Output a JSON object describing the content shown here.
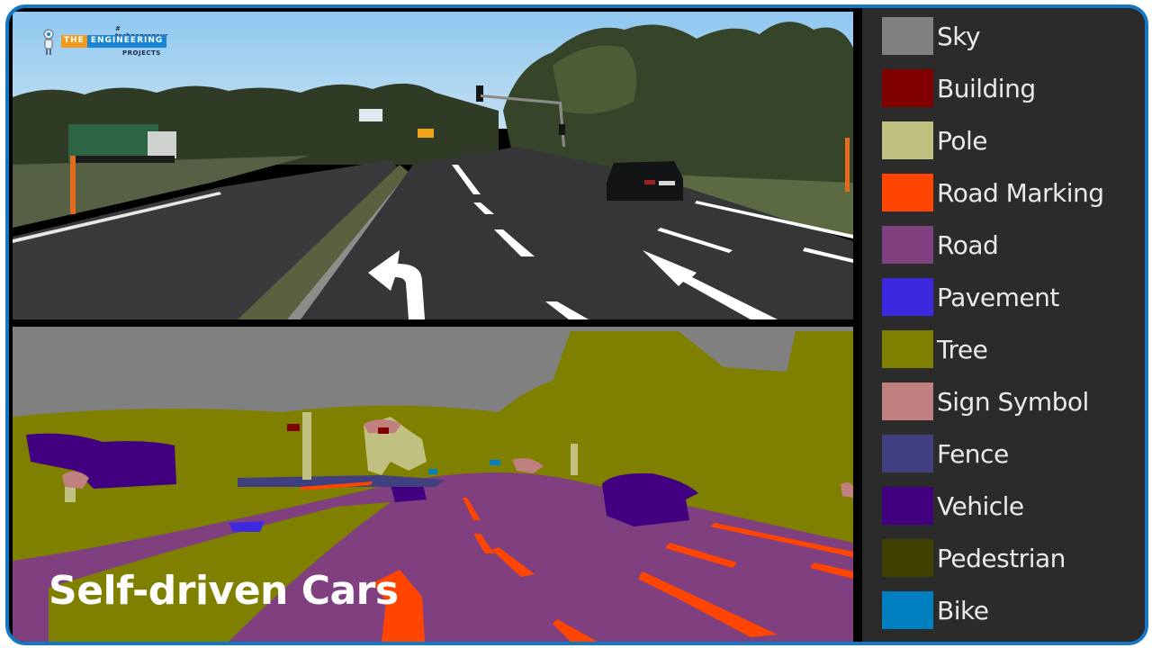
{
  "logo": {
    "tagline": "# technopreneur",
    "word_the": "THE",
    "word_engineering": "ENGINEERING",
    "word_projects": "PROJECTS"
  },
  "caption": "Self-driven Cars",
  "panels": {
    "camera": "road-camera-image",
    "segmentation": "semantic-segmentation-output"
  },
  "legend": {
    "items": [
      {
        "label": "Sky",
        "color": "#808080"
      },
      {
        "label": "Building",
        "color": "#800000"
      },
      {
        "label": "Pole",
        "color": "#c0c080"
      },
      {
        "label": "Road Marking",
        "color": "#ff4500"
      },
      {
        "label": "Road",
        "color": "#804080"
      },
      {
        "label": "Pavement",
        "color": "#3c28de"
      },
      {
        "label": "Tree",
        "color": "#808000"
      },
      {
        "label": "Sign Symbol",
        "color": "#c08080"
      },
      {
        "label": "Fence",
        "color": "#404080"
      },
      {
        "label": "Vehicle",
        "color": "#400080"
      },
      {
        "label": "Pedestrian",
        "color": "#404000"
      },
      {
        "label": "Bike",
        "color": "#0080c0"
      }
    ]
  }
}
